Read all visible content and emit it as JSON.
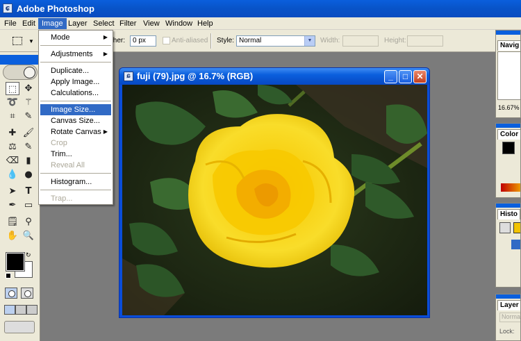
{
  "app": {
    "title": "Adobe Photoshop",
    "icon": "photoshop-icon"
  },
  "menubar": {
    "items": [
      "File",
      "Edit",
      "Image",
      "Layer",
      "Select",
      "Filter",
      "View",
      "Window",
      "Help"
    ],
    "active": "Image"
  },
  "options": {
    "feather_label": "ther:",
    "feather_value": "0 px",
    "anti_aliased_label": "Anti-aliased",
    "style_label": "Style:",
    "style_value": "Normal",
    "width_label": "Width:",
    "height_label": "Height:"
  },
  "image_menu": {
    "mode": "Mode",
    "adjustments": "Adjustments",
    "duplicate": "Duplicate...",
    "apply_image": "Apply Image...",
    "calculations": "Calculations...",
    "image_size": "Image Size...",
    "canvas_size": "Canvas Size...",
    "rotate_canvas": "Rotate Canvas",
    "crop": "Crop",
    "trim": "Trim...",
    "reveal_all": "Reveal All",
    "histogram": "Histogram...",
    "trap": "Trap...",
    "highlighted": "Image Size..."
  },
  "document": {
    "title": "fuji (79).jpg @ 16.7% (RGB)"
  },
  "palettes": {
    "navigator": "Navig",
    "navigator_zoom": "16.67%",
    "color": "Color",
    "history": "Histo",
    "layers": "Layer",
    "layers_mode": "Norma",
    "layers_lock": "Lock:"
  },
  "colors": {
    "titlebar_blue": "#0a5fdd",
    "menu_highlight": "#316ac5",
    "chrome_bg": "#ece9d8",
    "workspace_gray": "#7b7b7b",
    "rose_yellow": "#f7d417",
    "leaf_green": "#2f5a2a"
  }
}
